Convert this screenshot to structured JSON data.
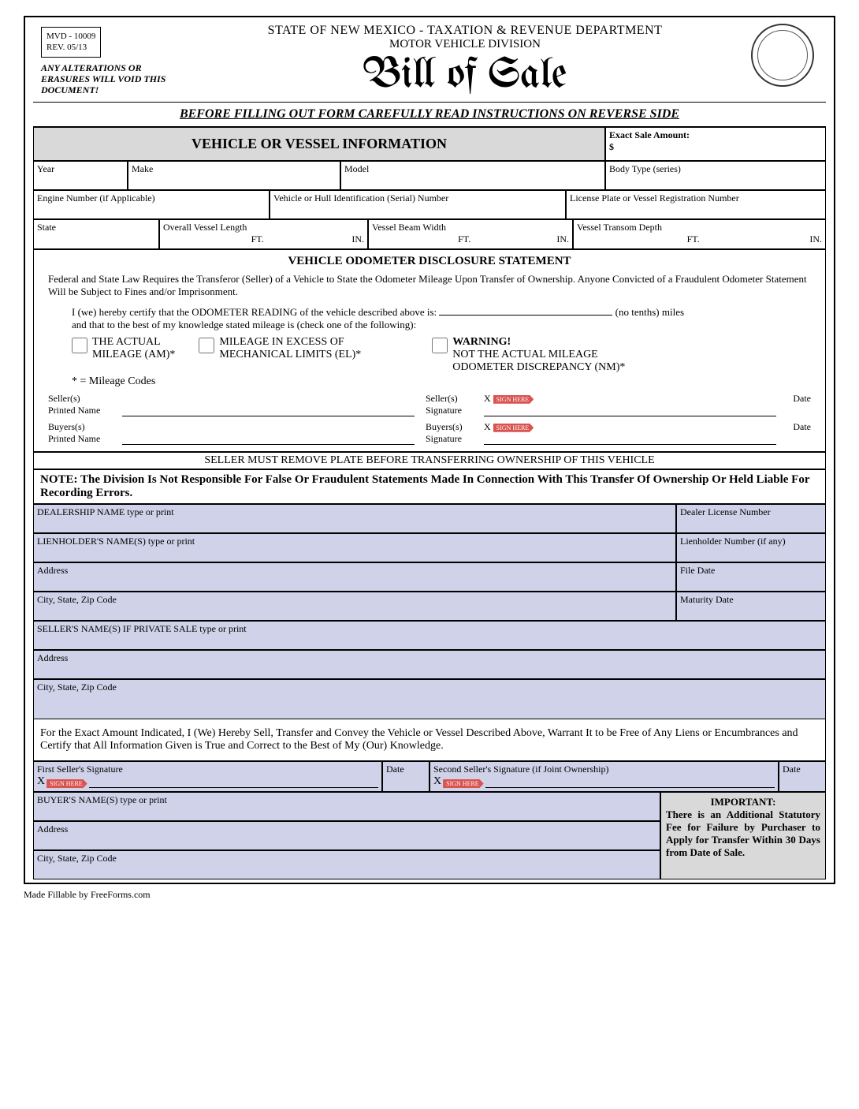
{
  "header": {
    "form_no": "MVD - 10009",
    "rev": "REV.    05/13",
    "alteration_warning": "ANY ALTERATIONS  OR ERASURES WILL VOID THIS DOCUMENT!",
    "dept": "STATE OF NEW MEXICO - TAXATION & REVENUE DEPARTMENT",
    "division": "MOTOR VEHICLE DIVISION",
    "title": "Bill of Sale"
  },
  "instruction_band": "BEFORE FILLING OUT FORM CAREFULLY READ INSTRUCTIONS ON REVERSE SIDE",
  "section1": {
    "heading": "VEHICLE OR VESSEL INFORMATION",
    "sale_amount_label": "Exact Sale Amount:",
    "currency": "$",
    "fields": {
      "year": "Year",
      "make": "Make",
      "model": "Model",
      "body_type": "Body Type (series)",
      "engine_no": "Engine Number (if Applicable)",
      "vin": "Vehicle or Hull Identification (Serial) Number",
      "plate": "License Plate or Vessel Registration Number",
      "state": "State",
      "length": "Overall Vessel Length",
      "beam": "Vessel Beam Width",
      "transom": "Vessel Transom Depth",
      "ft": "FT.",
      "in": "IN."
    }
  },
  "odometer": {
    "heading": "VEHICLE ODOMETER DISCLOSURE STATEMENT",
    "law": "Federal and State Law Requires the Transferor (Seller) of a Vehicle to State the Odometer Mileage Upon Transfer of Ownership.  Anyone Convicted of a Fraudulent Odometer Statement Will be Subject to Fines and/or Imprisonment.",
    "certify_pre": "I (we) hereby certify that the ODOMETER READING of the vehicle described above is:",
    "certify_post": "(no tenths) miles",
    "certify_line2": "and that to the best of my knowledge stated mileage is (check one of the following):",
    "opt1a": "THE ACTUAL",
    "opt1b": "MILEAGE (AM)*",
    "opt2a": "MILEAGE IN EXCESS OF",
    "opt2b": "MECHANICAL LIMITS (EL)*",
    "opt3a": "WARNING!",
    "opt3b": "NOT THE ACTUAL MILEAGE",
    "opt3c": "ODOMETER DISCREPANCY (NM)*",
    "codes": "* = Mileage Codes",
    "seller_printed": "Seller(s)\nPrinted Name",
    "seller_sig": "Seller(s)\nSignature",
    "buyer_printed": "Buyers(s)\nPrinted Name",
    "buyer_sig": "Buyers(s)\nSignature",
    "date": "Date",
    "sign_here": "SIGN HERE"
  },
  "remove_plate": "SELLER MUST REMOVE PLATE BEFORE TRANSFERRING OWNERSHIP OF THIS VEHICLE",
  "note": "NOTE: The Division Is Not Responsible For False Or Fraudulent Statements Made In Connection With This Transfer Of Ownership Or Held Liable For Recording Errors.",
  "dealer": {
    "dealership": "DEALERSHIP NAME type or print",
    "dealer_lic": "Dealer License Number",
    "lienholder": "LIENHOLDER'S NAME(S) type or print",
    "lien_no": "Lienholder Number (if any)",
    "address": "Address",
    "file_date": "File Date",
    "csz": "City, State, Zip Code",
    "maturity": "Maturity Date",
    "seller_name": "SELLER'S NAME(S) IF PRIVATE SALE type or print"
  },
  "convey": "For the Exact Amount Indicated, I (We) Hereby Sell, Transfer and Convey the Vehicle or Vessel Described  Above, Warrant It to be Free of Any Liens or Encumbrances and Certify that All Information Given is True and Correct to the Best of My (Our) Knowledge.",
  "sigs": {
    "first": "First Seller's Signature",
    "second": "Second Seller's Signature (if Joint Ownership)",
    "date": "Date",
    "x": "X"
  },
  "buyer": {
    "name": "BUYER'S NAME(S) type or print",
    "address": "Address",
    "csz": "City, State, Zip Code"
  },
  "important": {
    "heading": "IMPORTANT:",
    "body": "There is an Additional Statutory Fee for Failure by Purchaser to Apply for Transfer Within 30 Days from Date of  Sale."
  },
  "footer": "Made Fillable by FreeForms.com"
}
